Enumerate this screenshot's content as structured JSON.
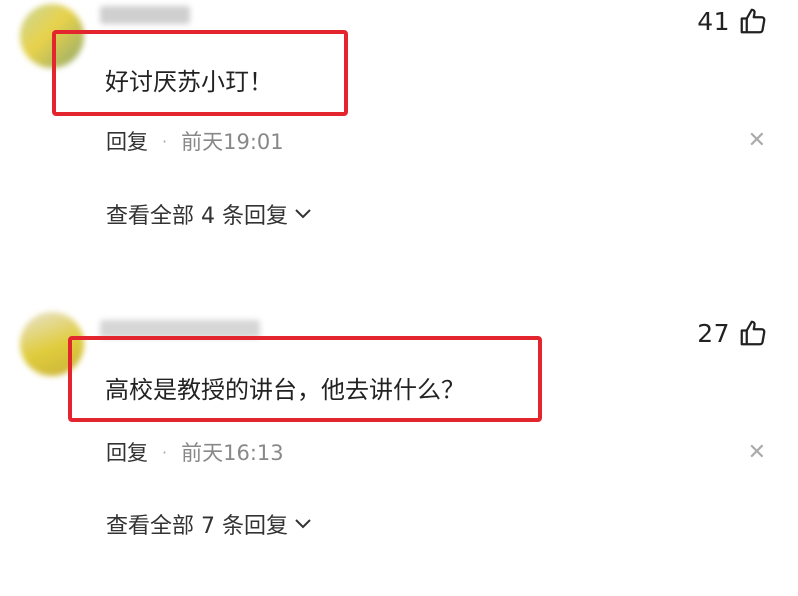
{
  "comments": [
    {
      "likes": "41",
      "text": "好讨厌苏小玎！",
      "reply_label": "回复",
      "separator": "·",
      "time": "前天19:01",
      "view_all_label": "查看全部 4 条回复",
      "close_icon": "close-icon",
      "like_icon": "thumb-up-icon"
    },
    {
      "likes": "27",
      "text": "高校是教授的讲台，他去讲什么？",
      "reply_label": "回复",
      "separator": "·",
      "time": "前天16:13",
      "view_all_label": "查看全部 7 条回复",
      "close_icon": "close-icon",
      "like_icon": "thumb-up-icon"
    }
  ],
  "colors": {
    "highlight_border": "#e3262e",
    "time_text": "#888888",
    "body_text": "#222222"
  }
}
